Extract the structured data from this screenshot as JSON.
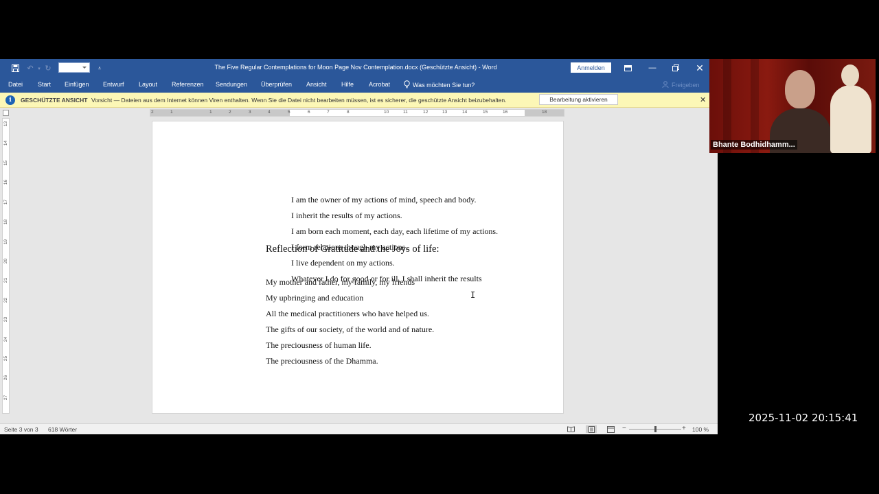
{
  "app": {
    "title": "The Five Regular Contemplations for Moon Page Nov Contemplation.docx (Geschützte Ansicht)  -  Word",
    "signin_label": "Anmelden"
  },
  "menu": {
    "items": [
      "Datei",
      "Start",
      "Einfügen",
      "Entwurf",
      "Layout",
      "Referenzen",
      "Sendungen",
      "Überprüfen",
      "Ansicht",
      "Hilfe",
      "Acrobat"
    ],
    "tell_me": "Was möchten Sie tun?",
    "share": "Freigeben"
  },
  "protected_view": {
    "title": "GESCHÜTZTE ANSICHT",
    "message": "Vorsicht — Dateien aus dem Internet können Viren enthalten. Wenn Sie die Datei nicht bearbeiten müssen, ist es sicherer, die geschützte Ansicht beizubehalten.",
    "enable_button": "Bearbeitung aktivieren",
    "icon": "info-shield-icon"
  },
  "ruler": {
    "h_ticks": [
      "2",
      "1",
      "1",
      "2",
      "3",
      "4",
      "5",
      "6",
      "7",
      "8",
      "9",
      "10",
      "11",
      "12",
      "13",
      "14",
      "15",
      "16",
      "18"
    ],
    "v_ticks": [
      "13",
      "14",
      "15",
      "16",
      "17",
      "18",
      "19",
      "20",
      "21",
      "22",
      "23",
      "24",
      "25",
      "26",
      "27"
    ]
  },
  "document": {
    "action_lines": [
      "I am the owner of my actions of mind, speech and body.",
      "I inherit the results of my actions.",
      "I am born each moment, each day, each lifetime of my actions.",
      "I form relations though my actions.",
      "I live dependent on my actions.",
      "Whatever I do for good or for ill, I shall inherit the results"
    ],
    "heading": "Reflection of Gratitude and the Joys of life:",
    "gratitude_lines": [
      "My mother and father, my family, my friends",
      "My upbringing and education",
      "All the medical practitioners who have helped us.",
      "The gifts of our society, of the world and of nature.",
      "The preciousness of human life.",
      "The preciousness of the Dhamma."
    ]
  },
  "status": {
    "page": "Seite 3 von 3",
    "words": "618 Wörter",
    "zoom": "100 %",
    "zoom_fraction": 0.5
  },
  "video": {
    "participant": "Bhante Bodhidhamm..."
  },
  "timestamp": "2025-11-02  20:15:41",
  "colors": {
    "word_blue": "#2b579a",
    "protected_bar": "#fcf7b6"
  }
}
